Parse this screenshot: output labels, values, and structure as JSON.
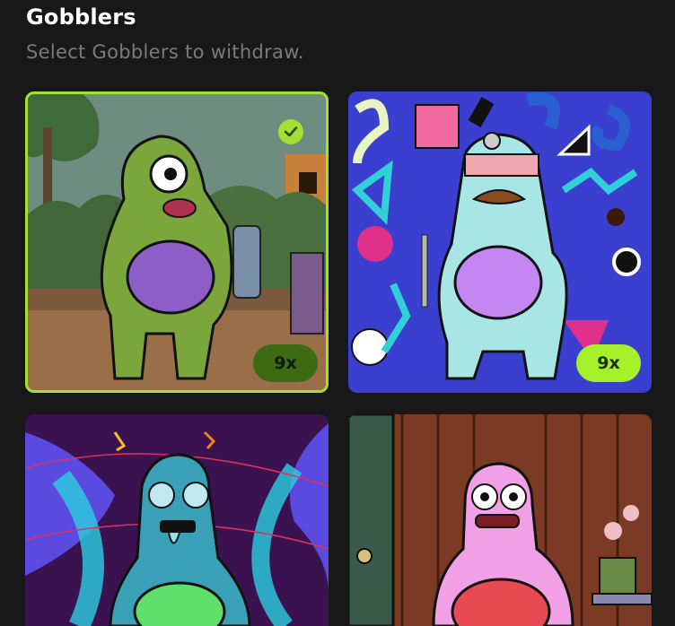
{
  "header": {
    "title": "Gobblers",
    "subtitle": "Select Gobblers to withdraw."
  },
  "colors": {
    "background": "#181818",
    "accent": "#a4e034",
    "subtitle": "#7a7a7a"
  },
  "gobblers": [
    {
      "selected": true,
      "multiplier": "9x",
      "body_color": "#7aa63c",
      "belly_color": "#8d5ec8",
      "scene": "backyard"
    },
    {
      "selected": false,
      "multiplier": "9x",
      "body_color": "#a8e6e6",
      "belly_color": "#c486f0",
      "scene": "memphis-pattern"
    },
    {
      "selected": false,
      "multiplier": null,
      "body_color": "#3aa0b8",
      "belly_color": "#5fe06a",
      "scene": "purple-psychedelic"
    },
    {
      "selected": false,
      "multiplier": null,
      "body_color": "#f2a0e6",
      "belly_color": "#e84a52",
      "scene": "wood-room"
    }
  ]
}
